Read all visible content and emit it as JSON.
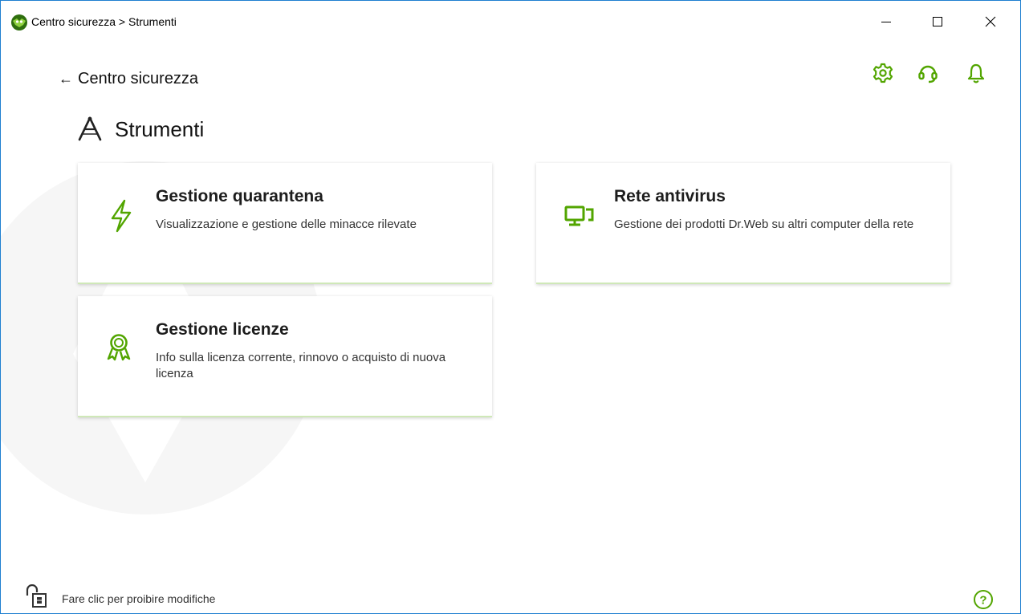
{
  "window": {
    "title": "Centro sicurezza > Strumenti",
    "controls": [
      "minimize-icon",
      "maximize-icon",
      "close-icon"
    ]
  },
  "nav": {
    "back_label": "Centro sicurezza",
    "back_icon": "arrow-left-icon"
  },
  "header_icons": [
    "gear-icon",
    "headset-icon",
    "bell-icon"
  ],
  "section": {
    "title": "Strumenti",
    "icon": "compass-icon"
  },
  "cards": [
    {
      "title": "Gestione quarantena",
      "description": "Visualizzazione e gestione delle minacce rilevate",
      "icon": "lightning-icon"
    },
    {
      "title": "Rete antivirus",
      "description": "Gestione dei prodotti Dr.Web su altri computer della rete",
      "icon": "computer-network-icon"
    },
    {
      "title": "Gestione licenze",
      "description": "Info sulla licenza corrente, rinnovo o acquisto di nuova licenza",
      "icon": "award-ribbon-icon"
    }
  ],
  "footer": {
    "lock_text": "Fare clic per proibire modifiche",
    "lock_icon": "padlock-open-icon",
    "help_icon": "help-icon"
  },
  "colors": {
    "accent": "#52a500",
    "window_border": "#1e7fd0",
    "card_shadow_accent": "#cfe8b8"
  }
}
